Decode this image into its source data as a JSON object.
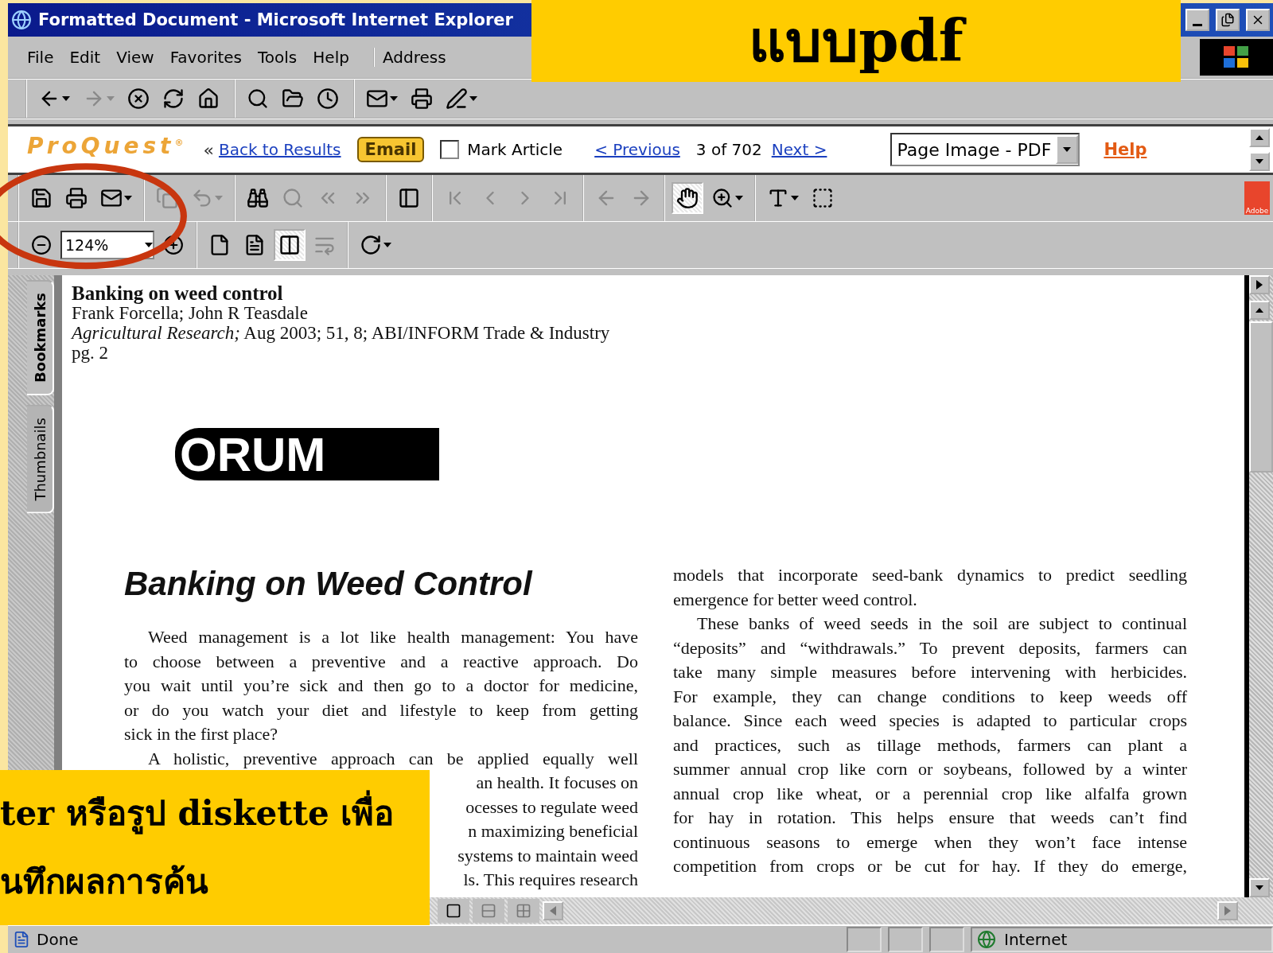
{
  "slide": {
    "banner": "แบบpdf",
    "caption": [
      "ter หรือรูป diskette เพื่อ",
      "นทึกผลการค้น"
    ]
  },
  "window": {
    "title": "Formatted Document - Microsoft Internet Explorer"
  },
  "menu": [
    "File",
    "Edit",
    "View",
    "Favorites",
    "Tools",
    "Help"
  ],
  "address_label": "Address",
  "ie_toolbar": [
    [
      {
        "kind": "back",
        "disabled": false,
        "menu": true
      },
      {
        "kind": "forward",
        "disabled": true,
        "menu": true
      },
      {
        "kind": "stop",
        "disabled": false
      },
      {
        "kind": "refresh",
        "disabled": false
      },
      {
        "kind": "home",
        "disabled": false
      }
    ],
    [
      {
        "kind": "search",
        "disabled": false
      },
      {
        "kind": "favorites",
        "disabled": false
      },
      {
        "kind": "history",
        "disabled": false
      }
    ],
    [
      {
        "kind": "mail",
        "disabled": false,
        "menu": true
      },
      {
        "kind": "print",
        "disabled": false
      },
      {
        "kind": "edit",
        "disabled": false,
        "menu": true
      }
    ]
  ],
  "proquest": {
    "logo": "ProQuest$^{®}$",
    "back_glyph": "«",
    "back_link": "Back to Results",
    "email": "Email",
    "mark": {
      "label": "Mark Article",
      "checked": false
    },
    "previous": "< Previous",
    "count": "3 of 702",
    "next": "Next >",
    "view_select": "Page Image - PDF",
    "help": "Help"
  },
  "acrobat_row1": [
    [
      {
        "kind": "save",
        "disabled": false,
        "selected": false
      },
      {
        "kind": "print",
        "disabled": false,
        "selected": false
      },
      {
        "kind": "email",
        "disabled": false,
        "selected": false,
        "menu": true
      }
    ],
    [
      {
        "kind": "copy",
        "disabled": true,
        "selected": false
      },
      {
        "kind": "undo",
        "disabled": true,
        "selected": false,
        "menu": true
      }
    ],
    [
      {
        "kind": "find",
        "disabled": false,
        "selected": false
      },
      {
        "kind": "search",
        "disabled": true,
        "selected": false
      },
      {
        "kind": "page_back",
        "disabled": true,
        "selected": false
      },
      {
        "kind": "page_forward",
        "disabled": true,
        "selected": false
      }
    ],
    [
      {
        "kind": "panes",
        "disabled": false,
        "selected": false
      }
    ],
    [
      {
        "kind": "first",
        "disabled": true,
        "selected": false
      },
      {
        "kind": "prev",
        "disabled": true,
        "selected": false
      },
      {
        "kind": "next",
        "disabled": true,
        "selected": false
      },
      {
        "kind": "last",
        "disabled": true,
        "selected": false
      }
    ],
    [
      {
        "kind": "go_back",
        "disabled": true,
        "selected": false
      },
      {
        "kind": "go_forward",
        "disabled": true,
        "selected": false
      }
    ],
    [
      {
        "kind": "hand",
        "disabled": false,
        "selected": true
      },
      {
        "kind": "zoom",
        "disabled": false,
        "selected": false,
        "menu": true
      }
    ],
    [
      {
        "kind": "text_select",
        "disabled": false,
        "selected": false,
        "menu": true
      },
      {
        "kind": "graphics_select",
        "disabled": false,
        "selected": false
      }
    ]
  ],
  "adobe_logo": "Adobe",
  "zoom": {
    "value": "124%"
  },
  "acrobat_row2": [
    [
      {
        "kind": "actual_size",
        "disabled": false,
        "selected": false
      },
      {
        "kind": "fit_page",
        "disabled": false,
        "selected": false
      },
      {
        "kind": "fit_width",
        "disabled": false,
        "selected": true
      },
      {
        "kind": "reflow",
        "disabled": true,
        "selected": false
      }
    ],
    [
      {
        "kind": "rotate",
        "disabled": false,
        "selected": false,
        "menu": true
      }
    ]
  ],
  "side_tabs": [
    {
      "label": "Bookmarks",
      "selected": true
    },
    {
      "label": "Thumbnails",
      "selected": false
    }
  ],
  "document": {
    "title": "Banking on weed control",
    "authors": "Frank Forcella; John R Teasdale",
    "citation": "*Agricultural Research;* Aug 2003; 51, 8; ABI/INFORM Trade & Industry",
    "page": "pg. 2",
    "logo": "ORUM",
    "headline": "Banking on Weed Control",
    "columns": [
      [
        {
          "kind": "first",
          "text": "Weed management is a lot like health management: You have"
        },
        {
          "kind": "body",
          "text": "to choose between a preventive and a reactive approach. Do"
        },
        {
          "kind": "body",
          "text": "you wait until you’re sick and then go to a doctor for medicine,"
        },
        {
          "kind": "body",
          "text": "or do you watch your diet and lifestyle to keep from getting"
        },
        {
          "kind": "last",
          "text": "sick in the first place?"
        },
        {
          "kind": "first",
          "text": "A holistic, preventive approach can be applied equally well"
        },
        {
          "kind": "fragment",
          "text": "an health. It focuses on"
        },
        {
          "kind": "fragment",
          "text": "ocesses to regulate weed"
        },
        {
          "kind": "fragment",
          "text": "n maximizing beneficial"
        },
        {
          "kind": "fragment",
          "text": "systems to maintain weed"
        },
        {
          "kind": "fragment",
          "text": "ls. This requires research"
        }
      ],
      [
        {
          "kind": "body",
          "text": "models that incorporate seed-bank dynamics to predict seedling"
        },
        {
          "kind": "last",
          "text": "emergence for better weed control."
        },
        {
          "kind": "first",
          "text": "These banks of weed seeds in the soil are subject to continual"
        },
        {
          "kind": "body",
          "text": "“deposits” and “withdrawals.” To prevent deposits, farmers can"
        },
        {
          "kind": "body",
          "text": "take many simple measures before intervening with herbicides."
        },
        {
          "kind": "body",
          "text": "For example, they can change conditions to keep weeds off"
        },
        {
          "kind": "body",
          "text": "balance. Since each weed species is adapted to particular crops"
        },
        {
          "kind": "body",
          "text": "and practices, such as tillage methods, farmers can plant a"
        },
        {
          "kind": "body",
          "text": "summer annual crop like corn or soybeans, followed by a winter"
        },
        {
          "kind": "body",
          "text": "annual crop like wheat, or a perennial crop like alfalfa grown"
        },
        {
          "kind": "body",
          "text": "for hay in rotation. This helps ensure that weeds can’t find"
        },
        {
          "kind": "body",
          "text": "continuous seasons to emerge when they won’t face intense"
        },
        {
          "kind": "body",
          "text": "competition from crops or be cut for hay. If they do emerge,"
        }
      ]
    ]
  },
  "status_bar": {
    "text": "Done",
    "zone": "Internet"
  }
}
